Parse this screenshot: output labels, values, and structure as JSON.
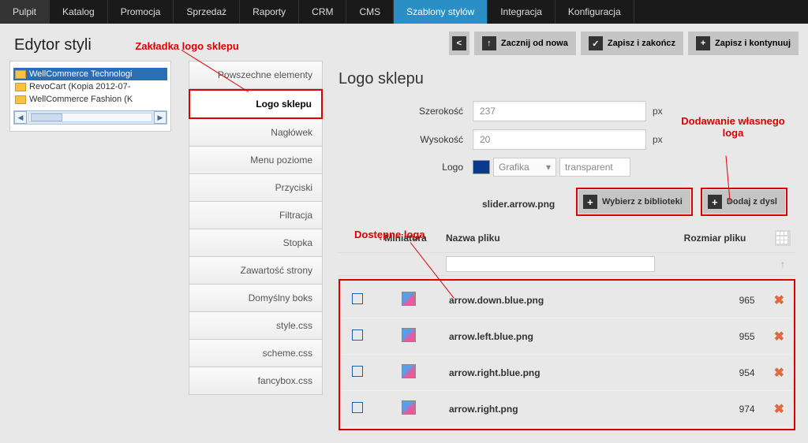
{
  "topnav": {
    "items": [
      "Pulpit",
      "Katalog",
      "Promocja",
      "Sprzedaż",
      "Raporty",
      "CRM",
      "CMS",
      "Szablony stylów",
      "Integracja",
      "Konfiguracja"
    ],
    "active_index": 7
  },
  "toolbar": {
    "back": "",
    "restart": "Zacznij od nowa",
    "save_close": "Zapisz i zakończ",
    "save_continue": "Zapisz i kontynuuj"
  },
  "page": {
    "title": "Edytor styli"
  },
  "sidebar": {
    "items": [
      {
        "label": "WellCommerce Technologi",
        "selected": true
      },
      {
        "label": "RevoCart (Kopia 2012-07-",
        "selected": false
      },
      {
        "label": "WellCommerce Fashion (K",
        "selected": false
      }
    ]
  },
  "section_nav": {
    "items": [
      "Powszechne elementy",
      "Logo sklepu",
      "Nagłówek",
      "Menu poziome",
      "Przyciski",
      "Filtracja",
      "Stopka",
      "Zawartość strony",
      "Domyślny boks",
      "style.css",
      "scheme.css",
      "fancybox.css"
    ],
    "selected_index": 1
  },
  "main": {
    "heading": "Logo sklepu",
    "width_label": "Szerokość",
    "width_value": "237",
    "height_label": "Wysokość",
    "height_value": "20",
    "logo_label": "Logo",
    "logo_mode": "Grafika",
    "logo_bg": "transparent",
    "unit": "px",
    "current_file": "slider.arrow.png",
    "choose_lib": "Wybierz z biblioteki",
    "add_disk": "Dodaj z dysl",
    "col_thumb": "Miniatura",
    "col_name": "Nazwa pliku",
    "col_size": "Rozmiar pliku",
    "files": [
      {
        "name": "arrow.down.blue.png",
        "size": "965"
      },
      {
        "name": "arrow.left.blue.png",
        "size": "955"
      },
      {
        "name": "arrow.right.blue.png",
        "size": "954"
      },
      {
        "name": "arrow.right.png",
        "size": "974"
      }
    ]
  },
  "annotations": {
    "tab": "Zakładka logo sklepu",
    "available": "Dostępne loga",
    "add_own_l1": "Dodawanie własnego",
    "add_own_l2": "loga"
  }
}
